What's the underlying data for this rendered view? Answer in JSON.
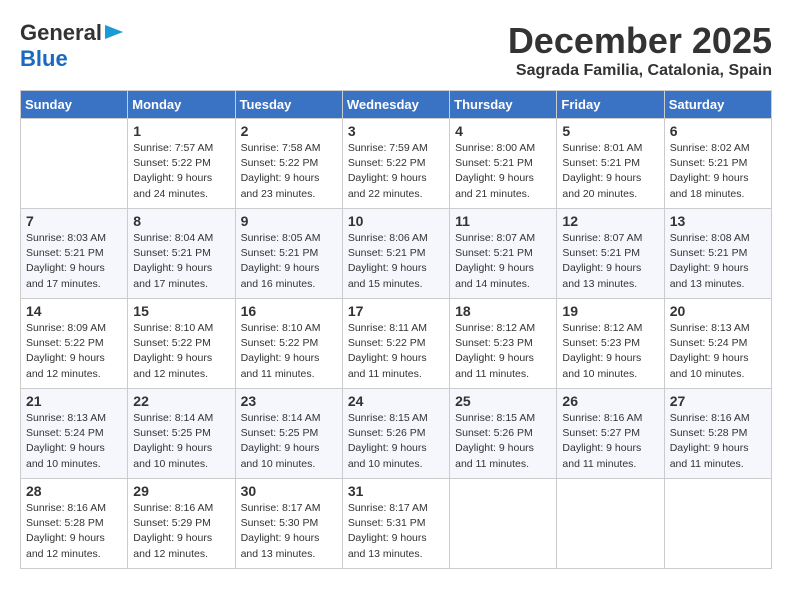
{
  "logo": {
    "line1": "General",
    "line2": "Blue"
  },
  "title": "December 2025",
  "subtitle": "Sagrada Familia, Catalonia, Spain",
  "header_days": [
    "Sunday",
    "Monday",
    "Tuesday",
    "Wednesday",
    "Thursday",
    "Friday",
    "Saturday"
  ],
  "weeks": [
    [
      {
        "day": "",
        "info": ""
      },
      {
        "day": "1",
        "info": "Sunrise: 7:57 AM\nSunset: 5:22 PM\nDaylight: 9 hours\nand 24 minutes."
      },
      {
        "day": "2",
        "info": "Sunrise: 7:58 AM\nSunset: 5:22 PM\nDaylight: 9 hours\nand 23 minutes."
      },
      {
        "day": "3",
        "info": "Sunrise: 7:59 AM\nSunset: 5:22 PM\nDaylight: 9 hours\nand 22 minutes."
      },
      {
        "day": "4",
        "info": "Sunrise: 8:00 AM\nSunset: 5:21 PM\nDaylight: 9 hours\nand 21 minutes."
      },
      {
        "day": "5",
        "info": "Sunrise: 8:01 AM\nSunset: 5:21 PM\nDaylight: 9 hours\nand 20 minutes."
      },
      {
        "day": "6",
        "info": "Sunrise: 8:02 AM\nSunset: 5:21 PM\nDaylight: 9 hours\nand 18 minutes."
      }
    ],
    [
      {
        "day": "7",
        "info": "Sunrise: 8:03 AM\nSunset: 5:21 PM\nDaylight: 9 hours\nand 17 minutes."
      },
      {
        "day": "8",
        "info": "Sunrise: 8:04 AM\nSunset: 5:21 PM\nDaylight: 9 hours\nand 17 minutes."
      },
      {
        "day": "9",
        "info": "Sunrise: 8:05 AM\nSunset: 5:21 PM\nDaylight: 9 hours\nand 16 minutes."
      },
      {
        "day": "10",
        "info": "Sunrise: 8:06 AM\nSunset: 5:21 PM\nDaylight: 9 hours\nand 15 minutes."
      },
      {
        "day": "11",
        "info": "Sunrise: 8:07 AM\nSunset: 5:21 PM\nDaylight: 9 hours\nand 14 minutes."
      },
      {
        "day": "12",
        "info": "Sunrise: 8:07 AM\nSunset: 5:21 PM\nDaylight: 9 hours\nand 13 minutes."
      },
      {
        "day": "13",
        "info": "Sunrise: 8:08 AM\nSunset: 5:21 PM\nDaylight: 9 hours\nand 13 minutes."
      }
    ],
    [
      {
        "day": "14",
        "info": "Sunrise: 8:09 AM\nSunset: 5:22 PM\nDaylight: 9 hours\nand 12 minutes."
      },
      {
        "day": "15",
        "info": "Sunrise: 8:10 AM\nSunset: 5:22 PM\nDaylight: 9 hours\nand 12 minutes."
      },
      {
        "day": "16",
        "info": "Sunrise: 8:10 AM\nSunset: 5:22 PM\nDaylight: 9 hours\nand 11 minutes."
      },
      {
        "day": "17",
        "info": "Sunrise: 8:11 AM\nSunset: 5:22 PM\nDaylight: 9 hours\nand 11 minutes."
      },
      {
        "day": "18",
        "info": "Sunrise: 8:12 AM\nSunset: 5:23 PM\nDaylight: 9 hours\nand 11 minutes."
      },
      {
        "day": "19",
        "info": "Sunrise: 8:12 AM\nSunset: 5:23 PM\nDaylight: 9 hours\nand 10 minutes."
      },
      {
        "day": "20",
        "info": "Sunrise: 8:13 AM\nSunset: 5:24 PM\nDaylight: 9 hours\nand 10 minutes."
      }
    ],
    [
      {
        "day": "21",
        "info": "Sunrise: 8:13 AM\nSunset: 5:24 PM\nDaylight: 9 hours\nand 10 minutes."
      },
      {
        "day": "22",
        "info": "Sunrise: 8:14 AM\nSunset: 5:25 PM\nDaylight: 9 hours\nand 10 minutes."
      },
      {
        "day": "23",
        "info": "Sunrise: 8:14 AM\nSunset: 5:25 PM\nDaylight: 9 hours\nand 10 minutes."
      },
      {
        "day": "24",
        "info": "Sunrise: 8:15 AM\nSunset: 5:26 PM\nDaylight: 9 hours\nand 10 minutes."
      },
      {
        "day": "25",
        "info": "Sunrise: 8:15 AM\nSunset: 5:26 PM\nDaylight: 9 hours\nand 11 minutes."
      },
      {
        "day": "26",
        "info": "Sunrise: 8:16 AM\nSunset: 5:27 PM\nDaylight: 9 hours\nand 11 minutes."
      },
      {
        "day": "27",
        "info": "Sunrise: 8:16 AM\nSunset: 5:28 PM\nDaylight: 9 hours\nand 11 minutes."
      }
    ],
    [
      {
        "day": "28",
        "info": "Sunrise: 8:16 AM\nSunset: 5:28 PM\nDaylight: 9 hours\nand 12 minutes."
      },
      {
        "day": "29",
        "info": "Sunrise: 8:16 AM\nSunset: 5:29 PM\nDaylight: 9 hours\nand 12 minutes."
      },
      {
        "day": "30",
        "info": "Sunrise: 8:17 AM\nSunset: 5:30 PM\nDaylight: 9 hours\nand 13 minutes."
      },
      {
        "day": "31",
        "info": "Sunrise: 8:17 AM\nSunset: 5:31 PM\nDaylight: 9 hours\nand 13 minutes."
      },
      {
        "day": "",
        "info": ""
      },
      {
        "day": "",
        "info": ""
      },
      {
        "day": "",
        "info": ""
      }
    ]
  ]
}
